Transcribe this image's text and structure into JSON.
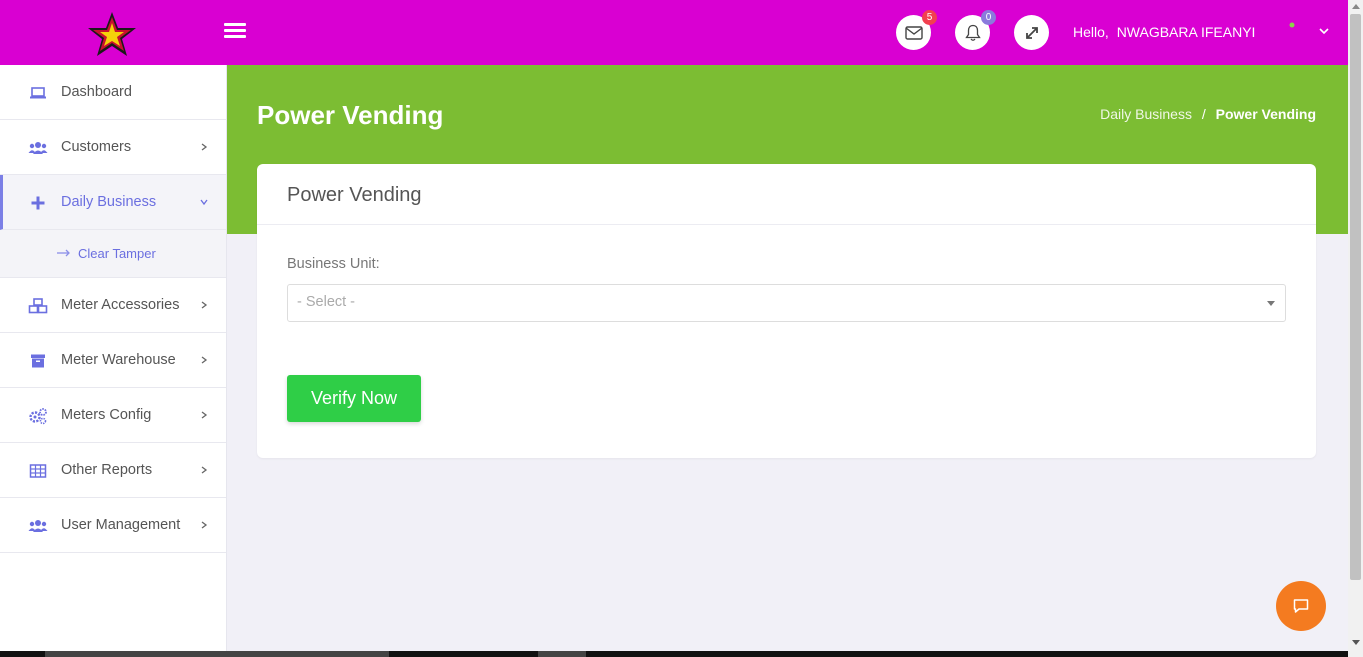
{
  "colors": {
    "topbar": "#d900d2",
    "hero": "#7cbd33",
    "accent": "#6b6fe0",
    "verify_button": "#2fce47",
    "chat_fab": "#f47b20",
    "badge_mail": "#f2404f",
    "badge_bell": "#8b7bdc"
  },
  "header": {
    "logo_icon": "star-logo-icon",
    "menu_icon": "hamburger-icon",
    "mail": {
      "icon": "envelope-icon",
      "count": "5"
    },
    "notifications": {
      "icon": "bell-icon",
      "count": "0"
    },
    "fullscreen_icon": "expand-icon",
    "greeting": "Hello,",
    "user_name": "NWAGBARA IFEANYI"
  },
  "sidebar": {
    "items": [
      {
        "label": "Dashboard",
        "icon": "laptop-icon"
      },
      {
        "label": "Customers",
        "icon": "users-icon"
      },
      {
        "label": "Daily Business",
        "icon": "plus-icon"
      },
      {
        "label": "Meter Accessories",
        "icon": "cubes-icon"
      },
      {
        "label": "Meter Warehouse",
        "icon": "archive-icon"
      },
      {
        "label": "Meters Config",
        "icon": "cogs-icon"
      },
      {
        "label": "Other Reports",
        "icon": "table-icon"
      },
      {
        "label": "User Management",
        "icon": "users-icon"
      }
    ],
    "daily_business_sub": [
      {
        "label": "Clear Tamper",
        "icon": "arrow-right-icon"
      }
    ]
  },
  "page": {
    "title": "Power Vending",
    "breadcrumb": {
      "parent": "Daily Business",
      "separator": "/",
      "current": "Power Vending"
    }
  },
  "card": {
    "title": "Power Vending",
    "business_unit_label": "Business Unit:",
    "business_unit_value": "- Select -",
    "verify_button": "Verify Now"
  },
  "chat_icon": "chat-bubble-icon"
}
